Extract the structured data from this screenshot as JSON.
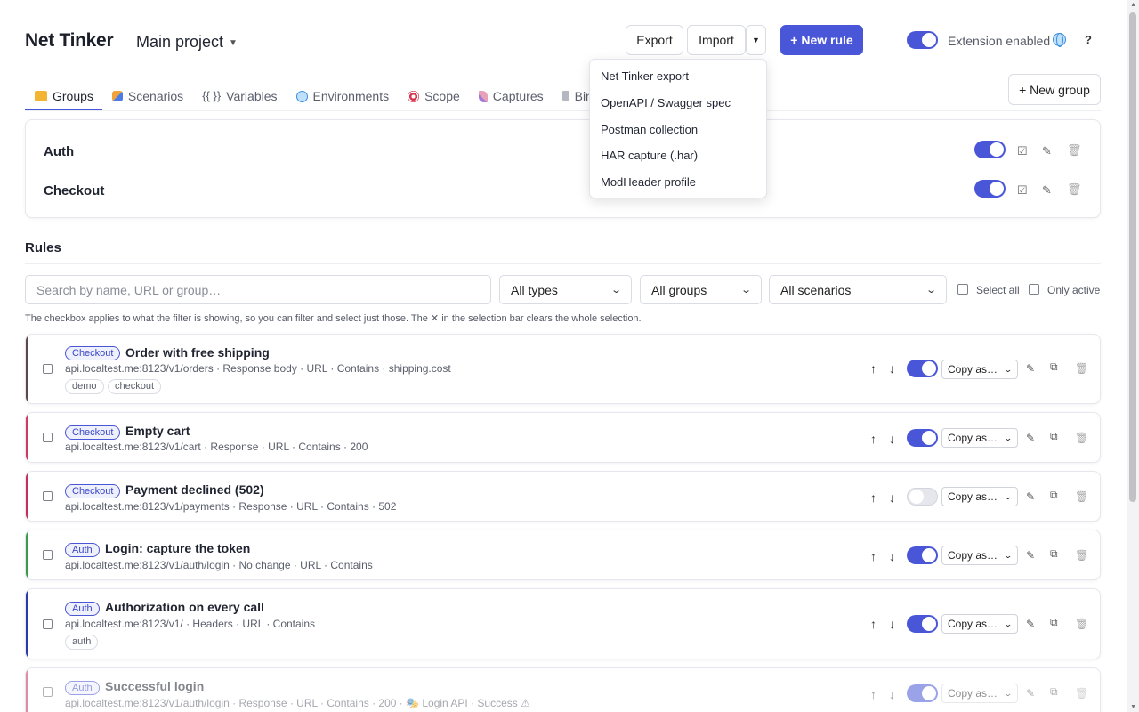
{
  "header": {
    "app_title": "Net Tinker",
    "project": "Main project",
    "export_label": "Export",
    "import_label": "Import",
    "new_rule_label": "+ New rule",
    "extension_label": "Extension enabled",
    "help_label": "?"
  },
  "tabs": [
    {
      "label": "Groups",
      "icon": "folder-icon"
    },
    {
      "label": "Scenarios",
      "icon": "scenarios-icon"
    },
    {
      "label": "Variables",
      "icon": "variables-icon",
      "glyph": "{{ }}"
    },
    {
      "label": "Environments",
      "icon": "globe-icon"
    },
    {
      "label": "Scope",
      "icon": "target-icon"
    },
    {
      "label": "Captures",
      "icon": "pipette-icon"
    },
    {
      "label": "Bin",
      "icon": "trash-icon"
    }
  ],
  "new_group_label": "+ New group",
  "groups": [
    {
      "name": "Auth",
      "enabled": true
    },
    {
      "name": "Checkout",
      "enabled": true
    }
  ],
  "import_menu": {
    "items": [
      "Net Tinker export",
      "OpenAPI / Swagger spec",
      "Postman collection",
      "HAR capture (.har)",
      "ModHeader profile"
    ]
  },
  "rules_section": {
    "title": "Rules",
    "search_placeholder": "Search by name, URL or group…",
    "filter_type": "All types",
    "filter_group": "All groups",
    "filter_scenario": "All scenarios",
    "select_all_label": "Select all",
    "only_active_label": "Only active",
    "hint": "The checkbox applies to what the filter is showing, so you can filter and select just those. The ✕ in the selection bar clears the whole selection.",
    "copy_as_label": "Copy as…"
  },
  "rules": [
    {
      "group": "Checkout",
      "title": "Order with free shipping",
      "meta": "api.localtest.me:8123/v1/orders · Response body · URL · Contains · shipping.cost",
      "tags": [
        "demo",
        "checkout"
      ],
      "enabled": true,
      "accent": "#5b4848"
    },
    {
      "group": "Checkout",
      "title": "Empty cart",
      "meta": "api.localtest.me:8123/v1/cart · Response · URL · Contains · 200",
      "tags": [],
      "enabled": true,
      "accent": "#d03a62"
    },
    {
      "group": "Checkout",
      "title": "Payment declined (502)",
      "meta": "api.localtest.me:8123/v1/payments · Response · URL · Contains · 502",
      "tags": [],
      "enabled": false,
      "accent": "#c0305a"
    },
    {
      "group": "Auth",
      "title": "Login: capture the token",
      "meta": "api.localtest.me:8123/v1/auth/login · No change · URL · Contains",
      "tags": [],
      "enabled": true,
      "accent": "#3a9a48"
    },
    {
      "group": "Auth",
      "title": "Authorization on every call",
      "meta": "api.localtest.me:8123/v1/ · Headers · URL · Contains",
      "tags": [
        "auth"
      ],
      "enabled": true,
      "accent": "#2a3aa8"
    },
    {
      "group": "Auth",
      "title": "Successful login",
      "meta": "api.localtest.me:8123/v1/auth/login · Response · URL · Contains · 200 · 🎭 Login API · Success ⚠",
      "tags": [],
      "enabled": true,
      "accent": "#e08aa8"
    }
  ],
  "colors": {
    "accent": "#4a56d8"
  }
}
